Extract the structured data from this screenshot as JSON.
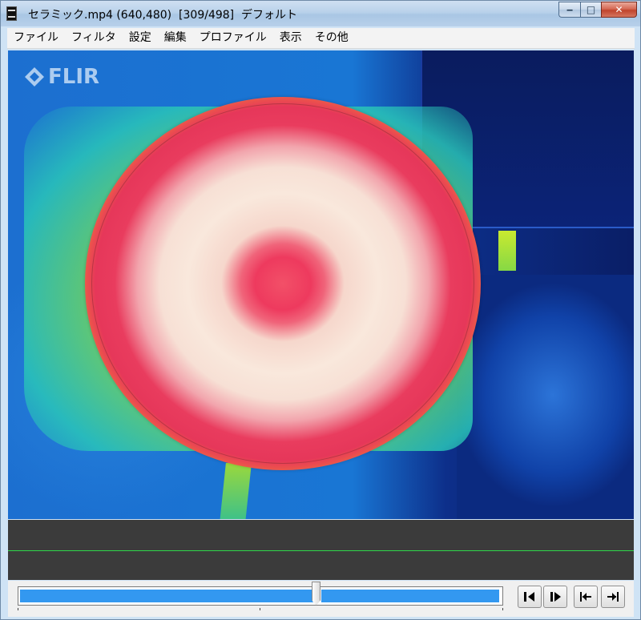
{
  "window": {
    "title": "セラミック.mp4 (640,480)  [309/498]  デフォルト",
    "buttons": {
      "minimize": "‒",
      "maximize": "□",
      "close": "✕"
    }
  },
  "menu": {
    "items": [
      "ファイル",
      "フィルタ",
      "設定",
      "編集",
      "プロファイル",
      "表示",
      "その他"
    ]
  },
  "video": {
    "logo_text": "FLIR",
    "current_frame": 309,
    "total_frames": 498
  },
  "seek": {
    "progress": 0.62
  },
  "controls": {
    "icons": [
      "prev-frame-icon",
      "next-frame-icon",
      "go-to-start-icon",
      "go-to-end-icon"
    ]
  },
  "colors": {
    "seek_fill": "#3398f0",
    "timeline_bg": "#3b3b3b",
    "timeline_line": "#2fd94a"
  }
}
